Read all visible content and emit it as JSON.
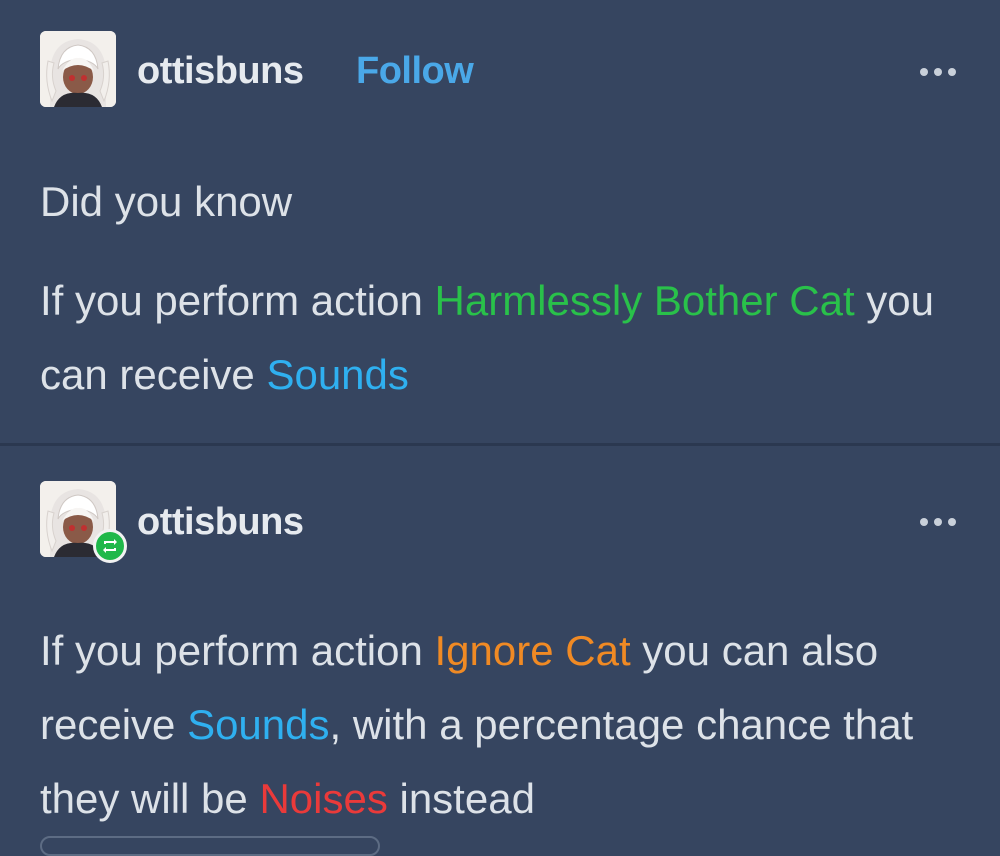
{
  "posts": [
    {
      "username": "ottisbuns",
      "follow_label": "Follow",
      "avatar_icon": "anime-girl-avatar-icon",
      "more_icon": "more-dots-icon",
      "paragraphs": {
        "p1": "Did you know",
        "p2": {
          "t1": "If you perform action ",
          "h1": "Harmlessly Bother Cat",
          "t2": " you can receive ",
          "h2": "Sounds"
        }
      }
    },
    {
      "username": "ottisbuns",
      "avatar_icon": "anime-girl-avatar-icon",
      "badge_icon": "reblog-icon",
      "more_icon": "more-dots-icon",
      "paragraph": {
        "t1": "If you perform action ",
        "h1": "Ignore Cat",
        "t2": " you can also receive ",
        "h2": "Sounds",
        "t3": ", with a percentage chance that they will be ",
        "h3": "Noises",
        "t4": " instead"
      }
    }
  ],
  "colors": {
    "background": "#364560",
    "green_highlight": "#29c14a",
    "blue_highlight": "#2fb0f0",
    "orange_highlight": "#f08a24",
    "red_highlight": "#ea3a3a",
    "follow": "#4aa8e8"
  }
}
